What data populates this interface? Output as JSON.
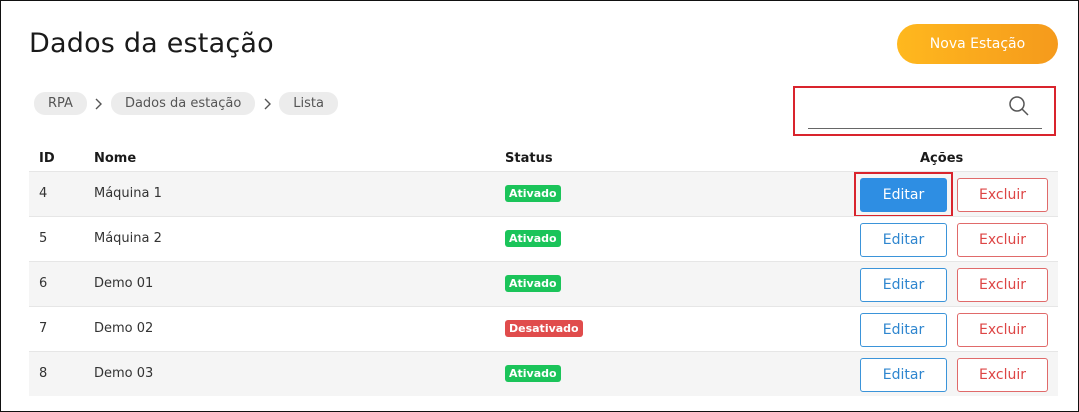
{
  "header": {
    "title": "Dados da estação",
    "new_button_label": "Nova Estação"
  },
  "breadcrumb": [
    "RPA",
    "Dados da estação",
    "Lista"
  ],
  "search": {
    "value": "",
    "placeholder": ""
  },
  "table": {
    "columns": {
      "id": "ID",
      "name": "Nome",
      "status": "Status",
      "actions": "Ações"
    },
    "rows": [
      {
        "id": "4",
        "name": "Máquina 1",
        "status": "Ativado",
        "active": true,
        "edit": "Editar",
        "delete": "Excluir"
      },
      {
        "id": "5",
        "name": "Máquina 2",
        "status": "Ativado",
        "active": true,
        "edit": "Editar",
        "delete": "Excluir"
      },
      {
        "id": "6",
        "name": "Demo 01",
        "status": "Ativado",
        "active": true,
        "edit": "Editar",
        "delete": "Excluir"
      },
      {
        "id": "7",
        "name": "Demo 02",
        "status": "Desativado",
        "active": false,
        "edit": "Editar",
        "delete": "Excluir"
      },
      {
        "id": "8",
        "name": "Demo 03",
        "status": "Ativado",
        "active": true,
        "edit": "Editar",
        "delete": "Excluir"
      }
    ]
  },
  "colors": {
    "accent_orange": "#f9a91d",
    "edit_blue": "#2e8ee3",
    "delete_red": "#dd4545",
    "status_on": "#1bc45a",
    "status_off": "#e04c4c",
    "highlight_red": "#d9242d"
  },
  "icons": {
    "search": "search-icon",
    "separator": "chevron-right-icon"
  }
}
